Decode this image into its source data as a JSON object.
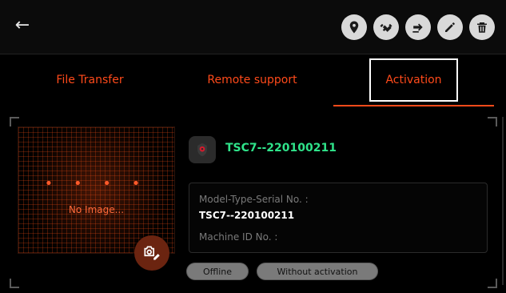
{
  "header": {
    "back_icon": "arrow-left-icon",
    "actions": [
      {
        "name": "location-button",
        "icon": "map-pin-icon"
      },
      {
        "name": "handshake-button",
        "icon": "handshake-icon"
      },
      {
        "name": "transfer-button",
        "icon": "hand-transfer-icon"
      },
      {
        "name": "edit-button",
        "icon": "pencil-icon"
      },
      {
        "name": "delete-button",
        "icon": "trash-icon"
      }
    ]
  },
  "tabs": [
    {
      "label": "File Transfer"
    },
    {
      "label": "Remote support"
    },
    {
      "label": "Activation"
    }
  ],
  "device": {
    "name": "TSC7--220100211",
    "image_placeholder_dots": "• • • •",
    "no_image_text": "No Image...",
    "model_type_serial_label": "Model-Type-Serial No. :",
    "model_type_serial_value": "TSC7--220100211",
    "machine_id_label": "Machine ID No. :"
  },
  "status": {
    "connection": "Offline",
    "activation": "Without activation"
  },
  "colors": {
    "accent": "#ff4a1a",
    "device_name": "#2fe38a"
  }
}
